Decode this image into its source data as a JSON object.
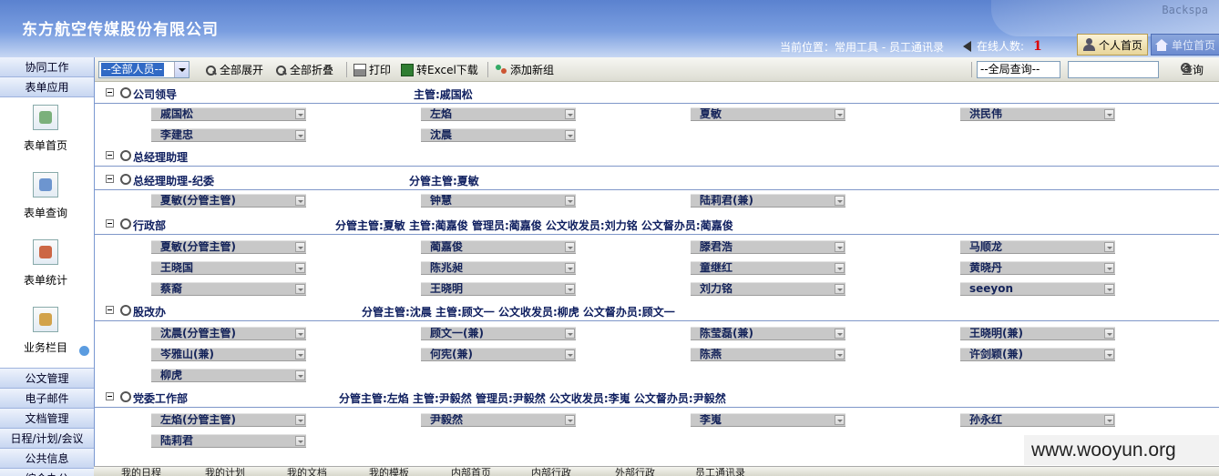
{
  "header": {
    "company": "东方航空传媒股份有限公司",
    "location": "当前位置：常用工具 - 员工通讯录",
    "online_label": "在线人数:",
    "online_count": "1",
    "home_tab": "个人首页",
    "second_tab": "单位首页",
    "kb_text": "Backspa"
  },
  "sidebar": {
    "top_items": [
      "协同工作",
      "表单应用"
    ],
    "panel_items": [
      "表单首页",
      "表单查询",
      "表单统计",
      "业务栏目"
    ],
    "bottom_items": [
      "公文管理",
      "电子邮件",
      "文档管理",
      "日程/计划/会议",
      "公共信息",
      "综合办公"
    ]
  },
  "toolbar": {
    "members_select": "--全部人员--",
    "expand_all": "全部展开",
    "collapse_all": "全部折叠",
    "print": "打印",
    "excel": "转Excel下载",
    "add_group": "添加新组",
    "global_select": "--全局查询--",
    "global_input_value": "",
    "query": "查询"
  },
  "groups": [
    {
      "name": "公司领导",
      "info": "主管:戚国松",
      "members": [
        "戚国松",
        "左焰",
        "夏敏",
        "洪民伟",
        "李建忠",
        "沈晨"
      ]
    },
    {
      "name": "总经理助理",
      "info": "",
      "members": []
    },
    {
      "name": "总经理助理-纪委",
      "info": "分管主管:夏敏",
      "members": [
        "夏敏(分管主管)",
        "钟慧",
        "陆莉君(兼)"
      ]
    },
    {
      "name": "行政部",
      "info": "分管主管:夏敏 主管:蔺嘉俊 管理员:蔺嘉俊 公文收发员:刘力铭 公文督办员:蔺嘉俊",
      "members": [
        "夏敏(分管主管)",
        "蔺嘉俊",
        "滕君浩",
        "马顺龙",
        "王晓国",
        "陈兆昶",
        "童继红",
        "黄晓丹",
        "蔡裔",
        "王晓明",
        "刘力铭",
        "seeyon"
      ]
    },
    {
      "name": "股改办",
      "info": "分管主管:沈晨 主管:顾文一  公文收发员:柳虎 公文督办员:顾文一",
      "members": [
        "沈晨(分管主管)",
        "顾文一(兼)",
        "陈莹磊(兼)",
        "王晓明(兼)",
        "岑雅山(兼)",
        "何宪(兼)",
        "陈燕",
        "许剑颖(兼)",
        "柳虎"
      ]
    },
    {
      "name": "党委工作部",
      "info": "分管主管:左焰 主管:尹毅然 管理员:尹毅然 公文收发员:李嵬 公文督办员:尹毅然",
      "members": [
        "左焰(分管主管)",
        "尹毅然",
        "李嵬",
        "孙永红",
        "陆莉君"
      ]
    }
  ],
  "statusbar": {
    "items": [
      "我的日程",
      "我的计划",
      "我的文档",
      "我的模板",
      "内部首页",
      "内部行政",
      "外部行政",
      "员工通讯录"
    ]
  },
  "watermark": "www.wooyun.org"
}
